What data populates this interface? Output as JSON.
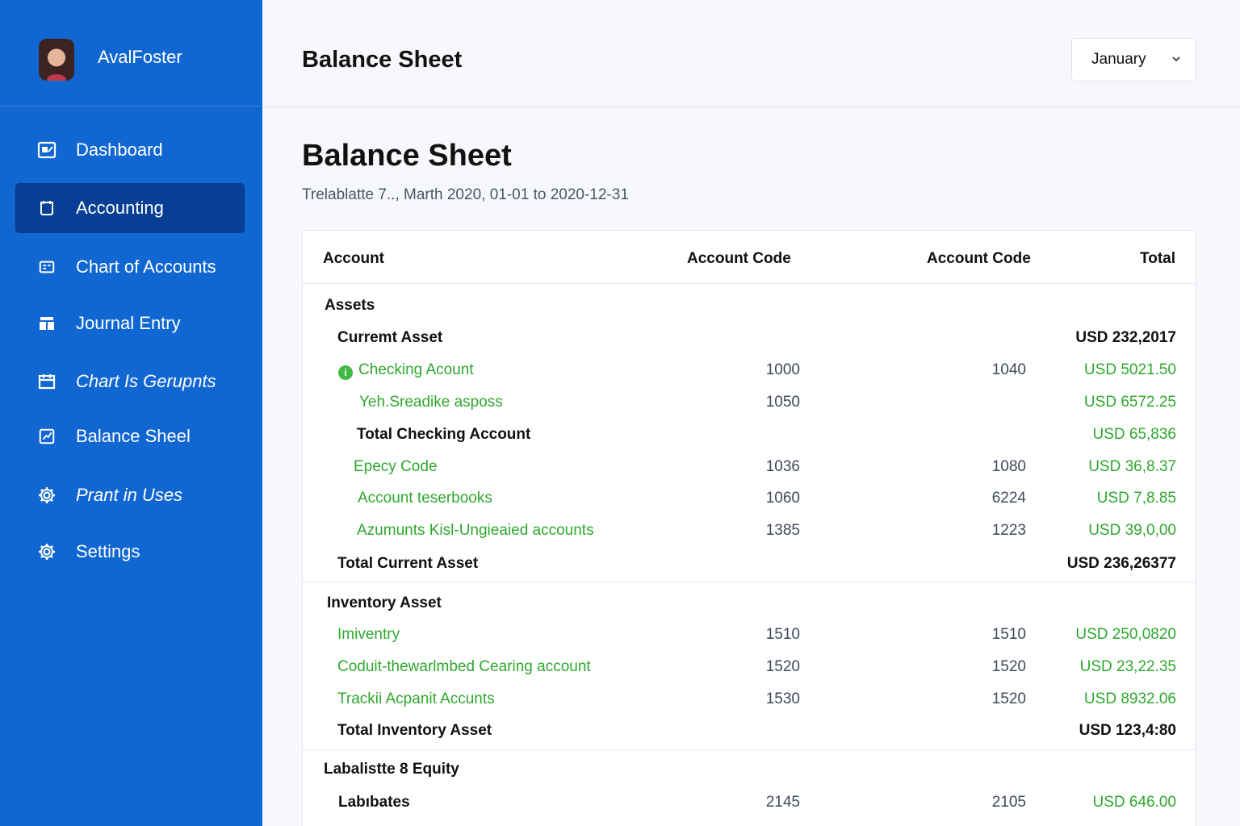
{
  "user": {
    "name": "AvalFoster"
  },
  "sidebar": {
    "items": [
      {
        "label": "Dashboard",
        "icon": "dashboard-icon",
        "active": false,
        "italic": false
      },
      {
        "label": "Accounting",
        "icon": "accounting-icon",
        "active": true,
        "italic": false
      },
      {
        "label": "Chart of Accounts",
        "icon": "chart-of-accounts-icon",
        "active": false,
        "italic": false
      },
      {
        "label": "Journal Entry",
        "icon": "journal-icon",
        "active": false,
        "italic": false
      },
      {
        "label": "Chart Is Gerupnts",
        "icon": "calendar-icon",
        "active": false,
        "italic": true
      },
      {
        "label": "Balance Sheel",
        "icon": "balance-sheet-icon",
        "active": false,
        "italic": false
      },
      {
        "label": "Prant in Uses",
        "icon": "gear-icon",
        "active": false,
        "italic": true
      },
      {
        "label": "Settings",
        "icon": "settings-gear-icon",
        "active": false,
        "italic": false
      }
    ]
  },
  "header": {
    "title": "Balance Sheet",
    "month": "January"
  },
  "main": {
    "title": "Balance Sheet",
    "subtitle": "Trelablatte 7.., Marth 2020, 01-01 to 2020-12-31"
  },
  "table": {
    "columns": [
      "Account",
      "Account Code",
      "Account Code",
      "Total"
    ],
    "rows": [
      {
        "name": "Assets",
        "code1": "",
        "code2": "",
        "total": "",
        "style": "bold"
      },
      {
        "name": "Curremt Asset",
        "code1": "",
        "code2": "",
        "total": "USD 232,2017",
        "style": "bold"
      },
      {
        "name": "Checking Acount",
        "code1": "1000",
        "code2": "1040",
        "total": "USD 5021.50",
        "style": "green",
        "info": true
      },
      {
        "name": "Yeh.Sreadike asposs",
        "code1": "1050",
        "code2": "",
        "total": "USD 6572.25",
        "style": "green"
      },
      {
        "name": "Total Checking Account",
        "code1": "",
        "code2": "",
        "total": "USD 65,836",
        "style": "bold-green-total"
      },
      {
        "name": "Epecy Code",
        "code1": "1036",
        "code2": "1080",
        "total": "USD 36,8.37",
        "style": "green"
      },
      {
        "name": "Account teserbooks",
        "code1": "1060",
        "code2": "6224",
        "total": "USD 7,8.85",
        "style": "green"
      },
      {
        "name": "Azumunts Kisl-Ungieaied accounts",
        "code1": "1385",
        "code2": "1223",
        "total": "USD 39,0,00",
        "style": "green"
      },
      {
        "name": "Total Current Asset",
        "code1": "",
        "code2": "",
        "total": "USD 236,26377",
        "style": "bold"
      },
      {
        "name": "Inventory Asset",
        "code1": "",
        "code2": "",
        "total": "",
        "style": "bold"
      },
      {
        "name": "Imiventry",
        "code1": "1510",
        "code2": "1510",
        "total": "USD 250,0820",
        "style": "green"
      },
      {
        "name": "Coduit-thewarlmbed Cearing account",
        "code1": "1520",
        "code2": "1520",
        "total": "USD 23,22.35",
        "style": "green"
      },
      {
        "name": "Trackii Acpanit Accunts",
        "code1": "1530",
        "code2": "1520",
        "total": "USD 8932.06",
        "style": "green"
      },
      {
        "name": "Total Inventory Asset",
        "code1": "",
        "code2": "",
        "total": "USD 123,4:80",
        "style": "bold"
      },
      {
        "name": "Labalistte 8 Equity",
        "code1": "",
        "code2": "",
        "total": "",
        "style": "bold"
      },
      {
        "name": "Labıbates",
        "code1": "2145",
        "code2": "2105",
        "total": "USD 646.00",
        "style": "bold-green-total"
      }
    ]
  },
  "colors": {
    "sidebar": "#1167d2",
    "active": "#063f93",
    "green": "#2ea82e"
  }
}
